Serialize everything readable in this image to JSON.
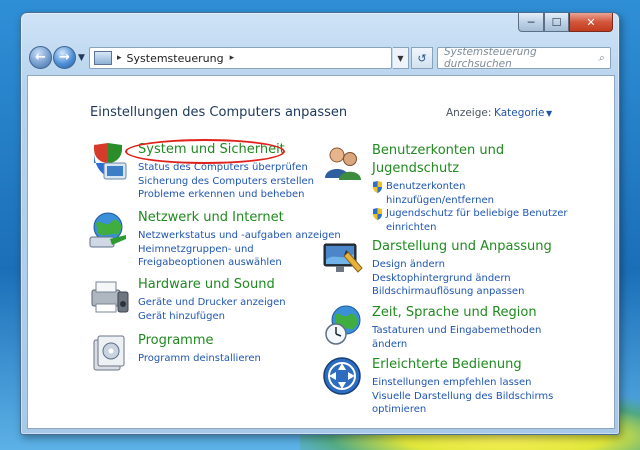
{
  "window": {
    "caption_buttons": {
      "minimize": "─",
      "maximize": "☐",
      "close": "✕"
    }
  },
  "nav": {
    "back_glyph": "←",
    "forward_glyph": "→",
    "breadcrumb_root_arrow": "▸",
    "breadcrumb": "Systemsteuerung",
    "breadcrumb_next_arrow": "▸",
    "refresh_glyph": "↺",
    "search_placeholder": "Systemsteuerung durchsuchen",
    "search_glyph": "⌕"
  },
  "header": {
    "title": "Einstellungen des Computers anpassen",
    "view_label": "Anzeige:",
    "view_value": "Kategorie",
    "view_caret": "▼"
  },
  "categories_left": [
    {
      "title": "System und Sicherheit",
      "icon": "system-security-icon",
      "links": [
        "Status des Computers überprüfen",
        "Sicherung des Computers erstellen",
        "Probleme erkennen und beheben"
      ]
    },
    {
      "title": "Netzwerk und Internet",
      "icon": "network-icon",
      "links": [
        "Netzwerkstatus und -aufgaben anzeigen",
        "Heimnetzgruppen- und",
        "Freigabeoptionen auswählen"
      ]
    },
    {
      "title": "Hardware und Sound",
      "icon": "hardware-sound-icon",
      "links": [
        "Geräte und Drucker anzeigen",
        "Gerät hinzufügen"
      ]
    },
    {
      "title": "Programme",
      "icon": "programs-icon",
      "links": [
        "Programm deinstallieren"
      ]
    }
  ],
  "categories_right": [
    {
      "title_line1": "Benutzerkonten und",
      "title_line2": "Jugendschutz",
      "icon": "user-accounts-icon",
      "links": [
        [
          "Benutzerkonten",
          "hinzufügen/entfernen"
        ],
        [
          "Jugendschutz für beliebige Benutzer",
          "einrichten"
        ]
      ]
    },
    {
      "title": "Darstellung und Anpassung",
      "icon": "appearance-icon",
      "links": [
        "Design ändern",
        "Desktophintergrund ändern",
        "Bildschirmauflösung anpassen"
      ]
    },
    {
      "title": "Zeit, Sprache und Region",
      "icon": "clock-language-icon",
      "links": [
        "Tastaturen und Eingabemethoden",
        "ändern"
      ]
    },
    {
      "title": "Erleichterte Bedienung",
      "icon": "ease-of-access-icon",
      "links": [
        "Einstellungen empfehlen lassen",
        "Visuelle Darstellung des Bildschirms",
        "optimieren"
      ]
    }
  ],
  "colors": {
    "category_title": "#1f8a1f",
    "link": "#1f56b0",
    "highlight_ring": "#e0201a"
  }
}
